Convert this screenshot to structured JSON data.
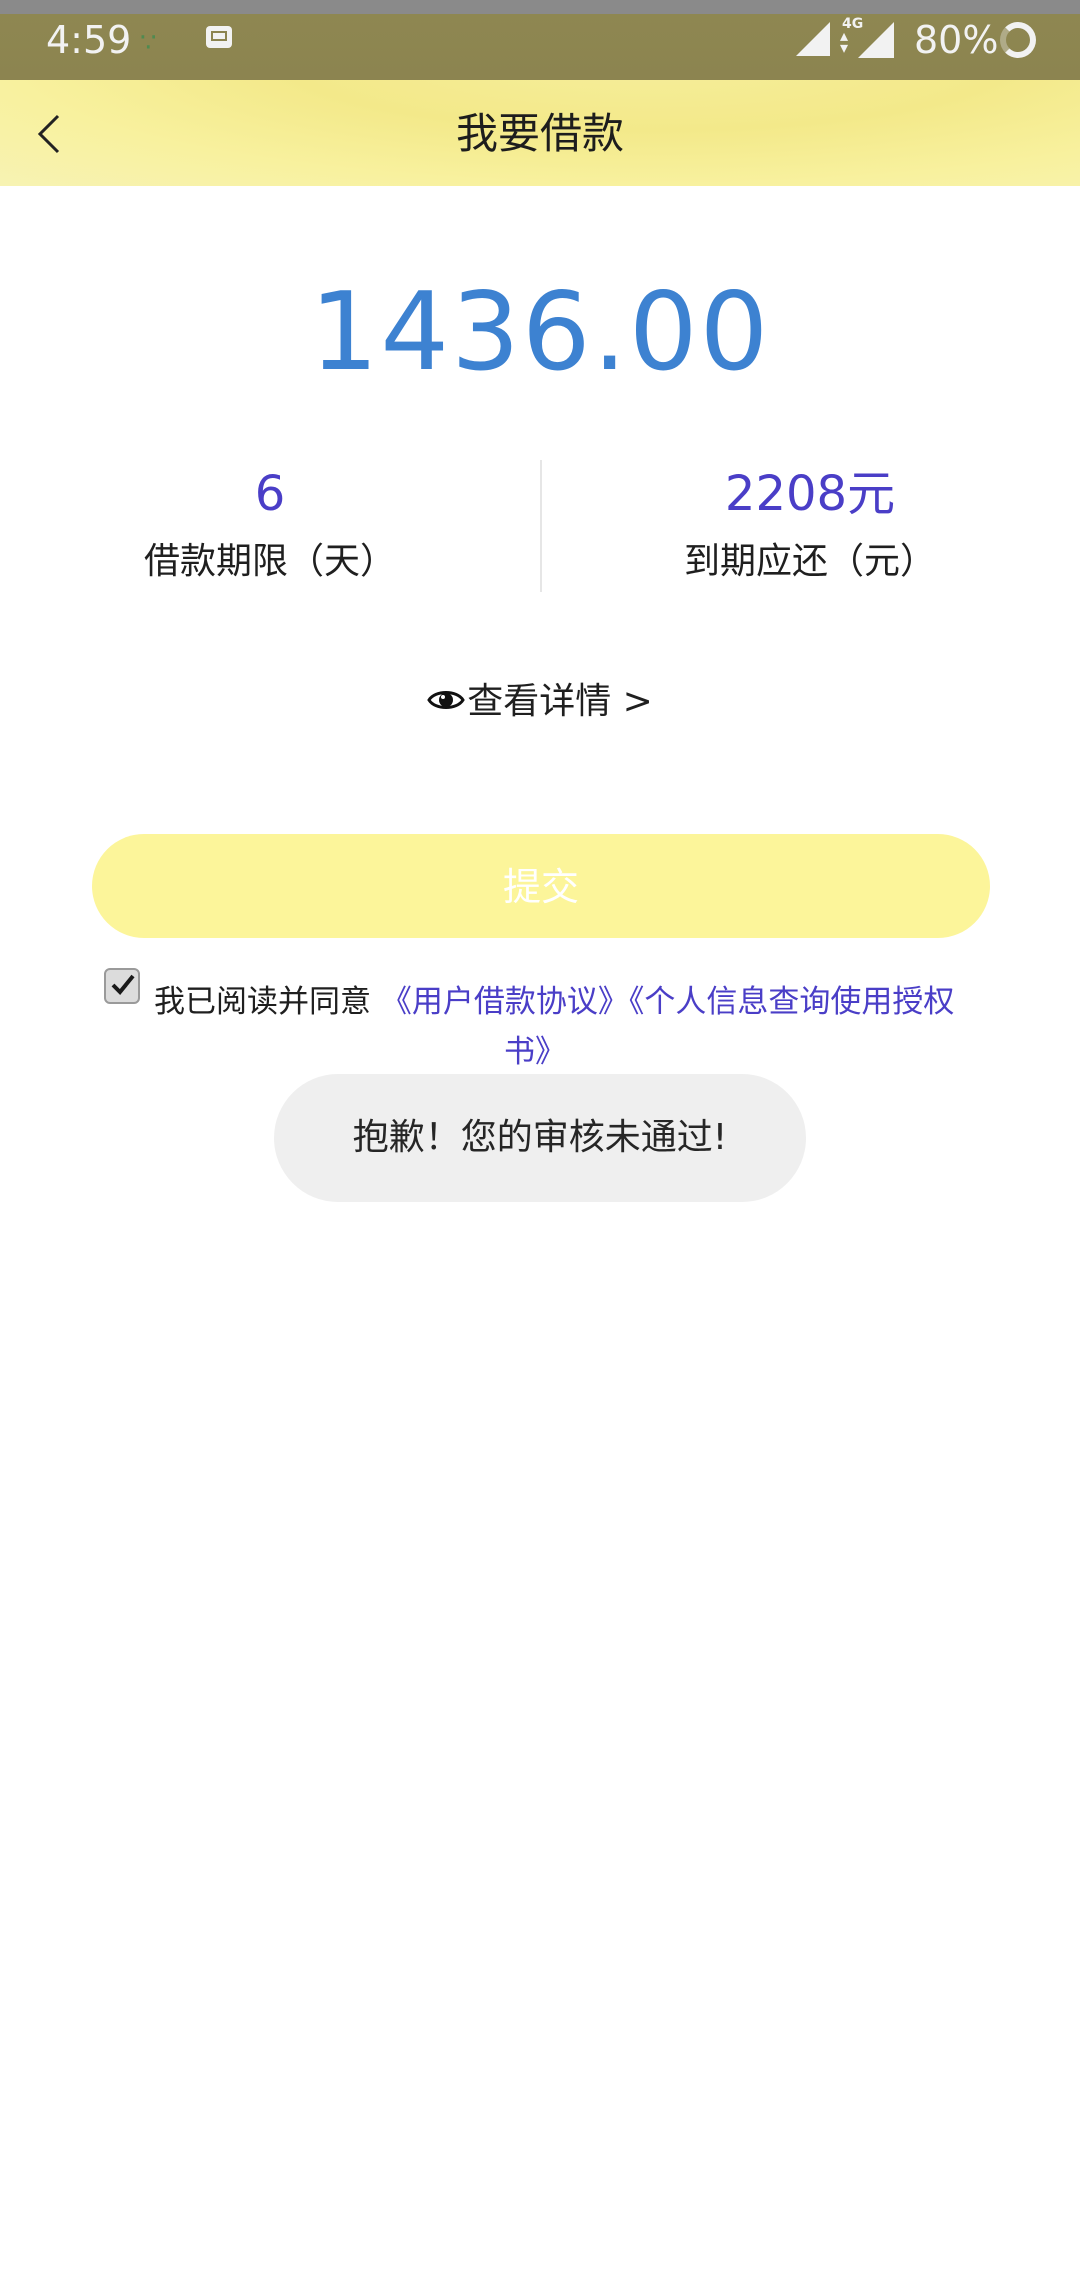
{
  "status_bar": {
    "time": "4:59",
    "network": "4G",
    "battery": "80%"
  },
  "header": {
    "title": "我要借款"
  },
  "loan": {
    "amount": "1436.00",
    "term_value": "6",
    "term_label": "借款期限（天）",
    "repay_value": "2208元",
    "repay_label": "到期应还（元）"
  },
  "details": {
    "label": "查看详情 >"
  },
  "submit": {
    "label": "提交"
  },
  "agreement": {
    "prefix": "我已阅读并同意",
    "link1": "《用户借款协议》",
    "link2_part1": "《个人信息查询使用授权",
    "link2_part2": "书》",
    "checked": true
  },
  "toast": {
    "message": "抱歉！您的审核未通过!"
  },
  "colors": {
    "amount": "#3d82d1",
    "accent_text": "#4a3ec7",
    "header_bg": "#f6ee9b",
    "submit_bg": "#fcf59a"
  },
  "icons": [
    "back-arrow-icon",
    "eye-icon",
    "checkbox-checked-icon",
    "signal-icon",
    "mail-icon",
    "battery-icon"
  ]
}
